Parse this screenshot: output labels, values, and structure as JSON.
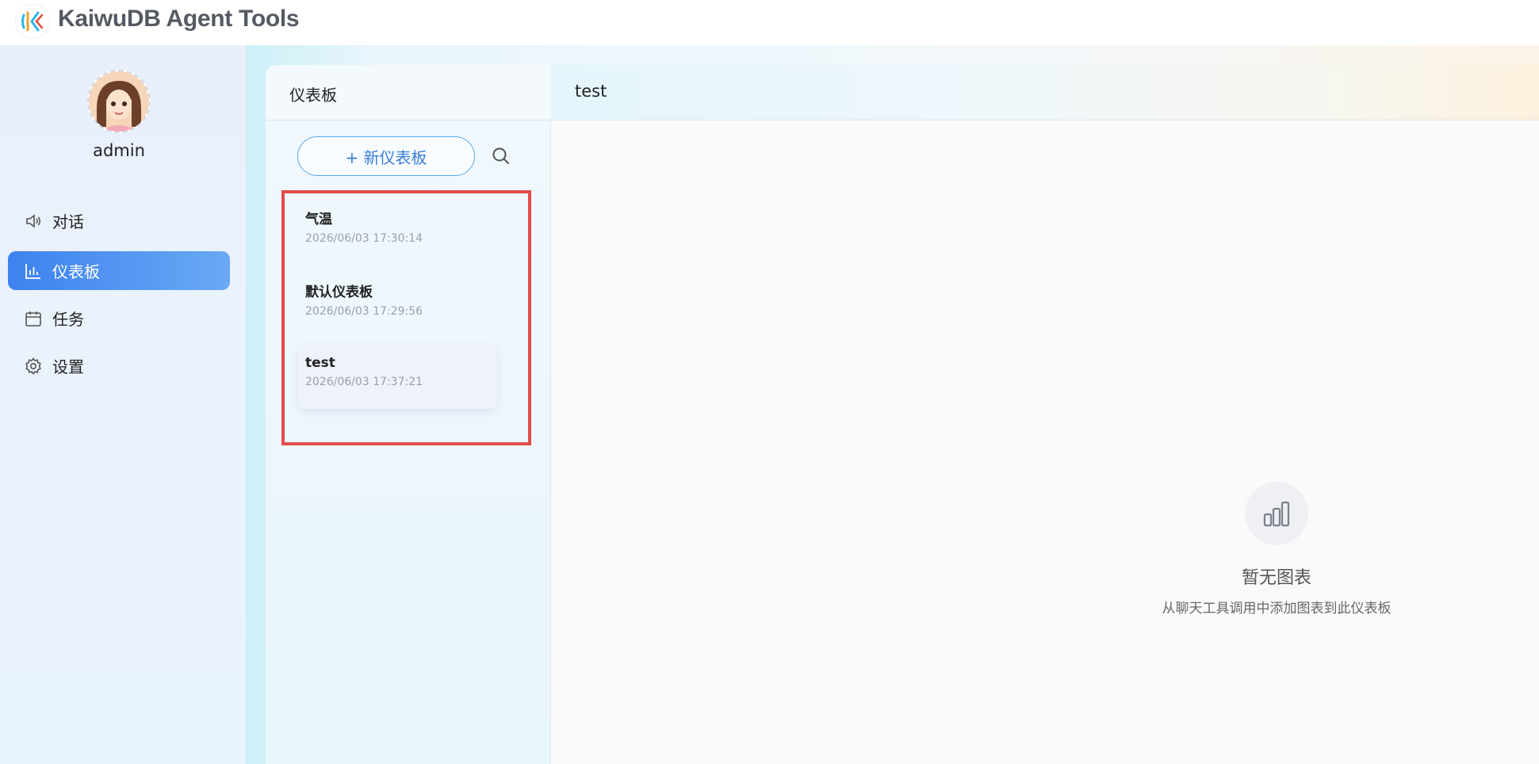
{
  "app": {
    "title": "KaiwuDB Agent Tools"
  },
  "user": {
    "name": "admin"
  },
  "sidebar": {
    "items": [
      {
        "label": "对话",
        "icon": "speaker-icon",
        "active": false
      },
      {
        "label": "仪表板",
        "icon": "bar-chart-icon",
        "active": true
      },
      {
        "label": "任务",
        "icon": "calendar-icon",
        "active": false
      },
      {
        "label": "设置",
        "icon": "gear-icon",
        "active": false
      }
    ]
  },
  "dashboard_list": {
    "title": "仪表板",
    "new_button_label": "+ 新仪表板",
    "items": [
      {
        "name": "气温",
        "time": "2026/06/03 17:30:14"
      },
      {
        "name": "默认仪表板",
        "time": "2026/06/03 17:29:56"
      },
      {
        "name": "test",
        "time": "2026/06/03 17:37:21",
        "selected": true
      }
    ]
  },
  "content": {
    "title": "test",
    "empty_title": "暂无图表",
    "empty_subtitle": "从聊天工具调用中添加图表到此仪表板"
  },
  "colors": {
    "accent": "#3d82ef",
    "highlight_border": "#e34b4b"
  }
}
